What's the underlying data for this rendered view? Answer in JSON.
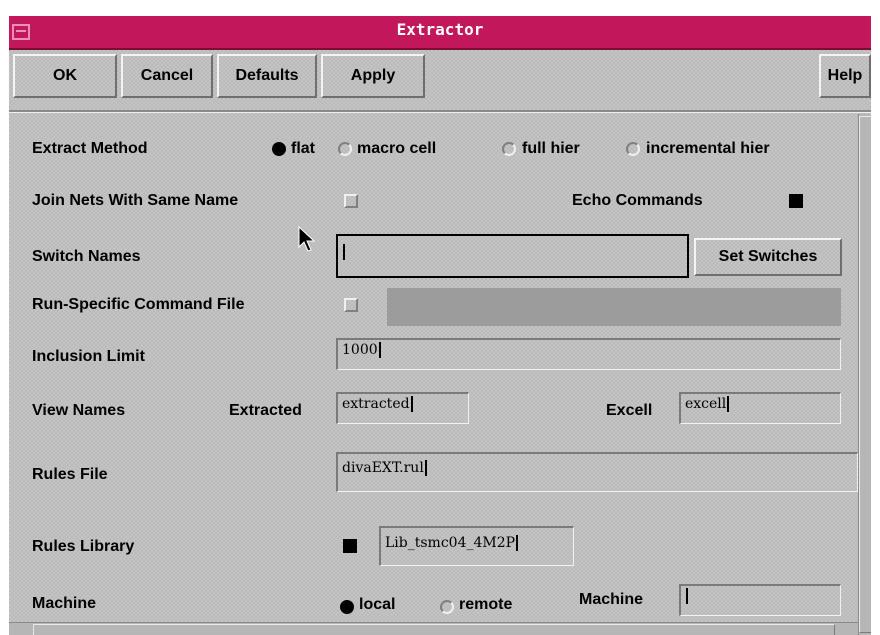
{
  "window": {
    "title": "Extractor"
  },
  "toolbar": {
    "ok": "OK",
    "cancel": "Cancel",
    "defaults": "Defaults",
    "apply": "Apply",
    "help": "Help"
  },
  "extract_method": {
    "label": "Extract Method",
    "options": [
      "flat",
      "macro cell",
      "full hier",
      "incremental hier"
    ],
    "selected": "flat"
  },
  "join_nets": {
    "label": "Join Nets With Same Name",
    "checked": false
  },
  "echo_commands": {
    "label": "Echo Commands",
    "checked": true
  },
  "switch_names": {
    "label": "Switch Names",
    "value": "",
    "button": "Set Switches"
  },
  "run_specific": {
    "label": "Run-Specific Command File",
    "checked": false,
    "value": ""
  },
  "inclusion_limit": {
    "label": "Inclusion Limit",
    "value": "1000"
  },
  "view_names": {
    "label": "View Names",
    "extracted_label": "Extracted",
    "extracted_value": "extracted",
    "excell_label": "Excell",
    "excell_value": "excell"
  },
  "rules_file": {
    "label": "Rules File",
    "value": "divaEXT.rul"
  },
  "rules_library": {
    "label": "Rules Library",
    "checked": true,
    "value": "Lib_tsmc04_4M2P"
  },
  "machine": {
    "label": "Machine",
    "options": [
      "local",
      "remote"
    ],
    "selected": "local",
    "machine_label": "Machine",
    "machine_value": ""
  },
  "colors": {
    "titlebar": "#c2185b",
    "panel": "#c4c4c4"
  }
}
